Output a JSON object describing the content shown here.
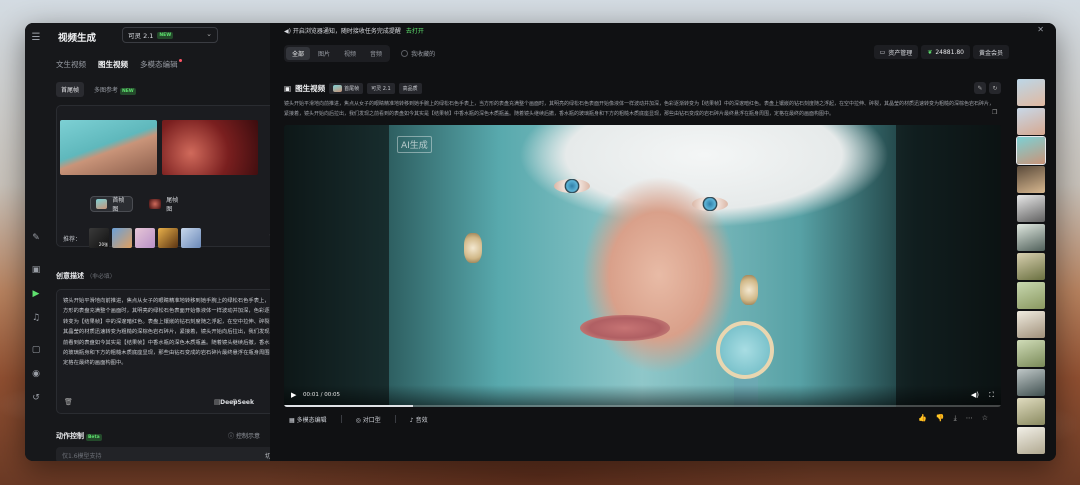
{
  "left": {
    "title": "视频生成",
    "model": {
      "name": "可灵 2.1",
      "badge": "NEW"
    },
    "modes": [
      "文生视频",
      "图生视频",
      "多模态编辑"
    ],
    "subtabs": [
      "首尾帧",
      "多图参考"
    ],
    "subtab_badge": "NEW",
    "frames": {
      "first": "首帧图",
      "last": "尾帧图"
    },
    "recommend_label": "推荐：",
    "recommend_count": "20张",
    "desc_title": "创意描述",
    "desc_optional": "（非必填）",
    "desc_text": "镜头开始平滑地向前推进，焦点从女子的眼睛精准地转移到她手腕上的绿松石色手表上，当方形的表盘充满整个画面时，其明亮的绿松石色表面开始像液体一样波动并加深，色彩逐渐转变为【结果帧】中的深邃暗红色。表盘上镶嵌的钻石刻度随之浮起，在空中拉伸、碎裂，其晶莹的材质迅速转变为粗糙的深棕色岩石碎片，紧接着，镜头开始向后拉出，我们发现之前看到的表盘如今其实是【结果帧】中香水瓶的深色木质瓶盖。随着镜头继续后撤，香水瓶的玻璃瓶身和下方的粗糙木质底座显现，那些由钻石变成的岩石碎片最终悬浮在瓶身周围，定格在最终的画面构图中。",
    "deepseek": "DeepSeek",
    "action_title": "动作控制",
    "action_badge": "Beta",
    "action_hint": "控制示意",
    "action_placeholder": "仅1.6模型支持",
    "action_switch": "切换"
  },
  "main": {
    "notice": "开启浏览器通知，随时接收任务完成提醒",
    "notice_link": "去打开",
    "filters": [
      "全部",
      "图片",
      "视频",
      "音频"
    ],
    "fav_label": "我收藏的",
    "asset_btn": "资产管理",
    "credits": "24881.80",
    "member": "黄金会员",
    "card": {
      "title": "图生视频",
      "chip_frame": "首尾帧",
      "chip_model": "可灵 2.1",
      "chip_quality": "高品质",
      "desc": "镜头开始平滑地向前推进，焦点从女子的眼睛精准地转移到她手腕上的绿松石色手表上，当方形的表盘充满整个画面时，其明亮的绿松石色表面开始像液体一样波动并加深，色彩逐渐转变为【结果帧】中的深邃暗红色。表盘上镶嵌的钻石刻度随之浮起，在空中拉伸、碎裂，其晶莹的材质迅速转变为粗糙的深棕色岩石碎片，紧接着，镜头开始向后拉出，我们发现之前看到的表盘如今其实是【结果帧】中香水瓶的深色木质瓶盖。随着镜头继续后撤，香水瓶的玻璃瓶身和下方的粗糙木质底座显现，那些由钻石变成的岩石碎片最终悬浮在瓶身周围，定格在最终的画面构图中。",
      "ai_tag": "AI生成",
      "time": "00:01 / 00:05",
      "progress": 0.18,
      "actions": [
        "多模态编辑",
        "对口型",
        "音效"
      ]
    }
  },
  "colors": {
    "accent": "#5ee06e",
    "bg": "#151619"
  }
}
